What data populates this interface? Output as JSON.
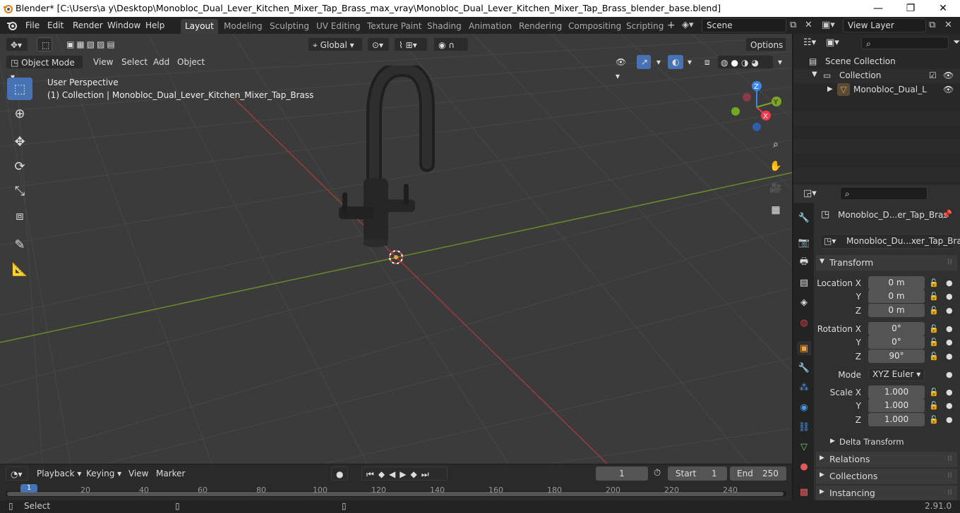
{
  "window": {
    "title": "Blender* [C:\\Users\\a y\\Desktop\\Monobloc_Dual_Lever_Kitchen_Mixer_Tap_Brass_max_vray\\Monobloc_Dual_Lever_Kitchen_Mixer_Tap_Brass_blender_base.blend]",
    "minimize": "—",
    "maximize": "❐",
    "close": "✕"
  },
  "menu": [
    "File",
    "Edit",
    "Render",
    "Window",
    "Help"
  ],
  "workspaces": [
    "Layout",
    "Modeling",
    "Sculpting",
    "UV Editing",
    "Texture Paint",
    "Shading",
    "Animation",
    "Rendering",
    "Compositing",
    "Scripting"
  ],
  "scene": {
    "label": "Scene",
    "view_layer": "View Layer"
  },
  "viewport_header": {
    "transform_orientation": "Global",
    "options": "Options",
    "mode": "Object Mode",
    "menus": [
      "View",
      "Select",
      "Add",
      "Object"
    ]
  },
  "viewport": {
    "perspective": "User Perspective",
    "collection_info": "(1) Collection | Monobloc_Dual_Lever_Kitchen_Mixer_Tap_Brass",
    "gizmo": {
      "x": "X",
      "y": "Y",
      "z": "Z"
    }
  },
  "outliner": {
    "scene_collection": "Scene Collection",
    "collection": "Collection",
    "object": "Monobloc_Dual_Leve"
  },
  "properties": {
    "object_name": "Monobloc_D...er_Tap_Bras",
    "object_field": "Monobloc_Du...xer_Tap_Brass",
    "transform_header": "Transform",
    "location": {
      "label_x": "Location X",
      "label_y": "Y",
      "label_z": "Z",
      "x": "0 m",
      "y": "0 m",
      "z": "0 m"
    },
    "rotation": {
      "label_x": "Rotation X",
      "label_y": "Y",
      "label_z": "Z",
      "x": "0°",
      "y": "0°",
      "z": "90°"
    },
    "mode_label": "Mode",
    "mode_value": "XYZ Euler",
    "scale": {
      "label_x": "Scale X",
      "label_y": "Y",
      "label_z": "Z",
      "x": "1.000",
      "y": "1.000",
      "z": "1.000"
    },
    "delta_transform": "Delta Transform",
    "sections": [
      "Relations",
      "Collections",
      "Instancing"
    ]
  },
  "timeline": {
    "menus": [
      "Playback",
      "Keying",
      "View",
      "Marker"
    ],
    "current_frame": "1",
    "start_label": "Start",
    "start": "1",
    "end_label": "End",
    "end": "250",
    "ticks": [
      "1",
      "20",
      "40",
      "60",
      "80",
      "100",
      "120",
      "140",
      "160",
      "180",
      "200",
      "220",
      "240"
    ]
  },
  "status": {
    "select": "Select",
    "version": "2.91.0"
  },
  "colors": {
    "accent": "#4772b3",
    "x_axis": "#9b3c3c",
    "y_axis": "#6c8a2c",
    "gizmo_x": "#f0394f",
    "gizmo_y": "#7da426",
    "gizmo_z": "#3b86e8"
  }
}
